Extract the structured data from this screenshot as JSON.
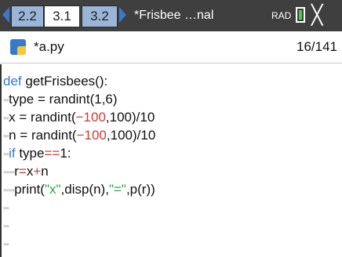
{
  "tabs": [
    {
      "label": "2.2"
    },
    {
      "label": "3.1"
    },
    {
      "label": "3.2"
    }
  ],
  "document_title": "*Frisbee …nal",
  "angle_mode": "RAD",
  "file": {
    "name": "*a.py",
    "line_position": "16/141"
  },
  "code": {
    "l1": {
      "kw": "def",
      "text": " getFrisbees():"
    },
    "l2": {
      "dots": "••",
      "text": "type = randint(1,6)"
    },
    "l3": {
      "dots": "••",
      "a": "x = randint(",
      "n1": "−100",
      "b": ",100)/10"
    },
    "l4": {
      "dots": "••",
      "a": "n = randint(",
      "n1": "−100",
      "b": ",100)/10"
    },
    "l5": {
      "dots": "••",
      "kw": "if",
      "a": " type",
      "op": "==",
      "b": "1:"
    },
    "l6": {
      "dots": "••••",
      "a": "r",
      "op1": "=",
      "b": "x",
      "op2": "+",
      "c": "n"
    },
    "l7": {
      "dots": "••••",
      "a": "print(",
      "s1": "\"x\"",
      "b": ",disp(n),",
      "s2": "\"=\"",
      "c": ",p(r))"
    },
    "l8": {
      "dots": "••"
    },
    "l9": {
      "dots": "••"
    },
    "l10": {
      "dots": "••"
    }
  },
  "colors": {
    "keyword": "#3a78c8",
    "operator": "#d13b34",
    "string": "#2aa84a",
    "battery": "#41d140"
  }
}
